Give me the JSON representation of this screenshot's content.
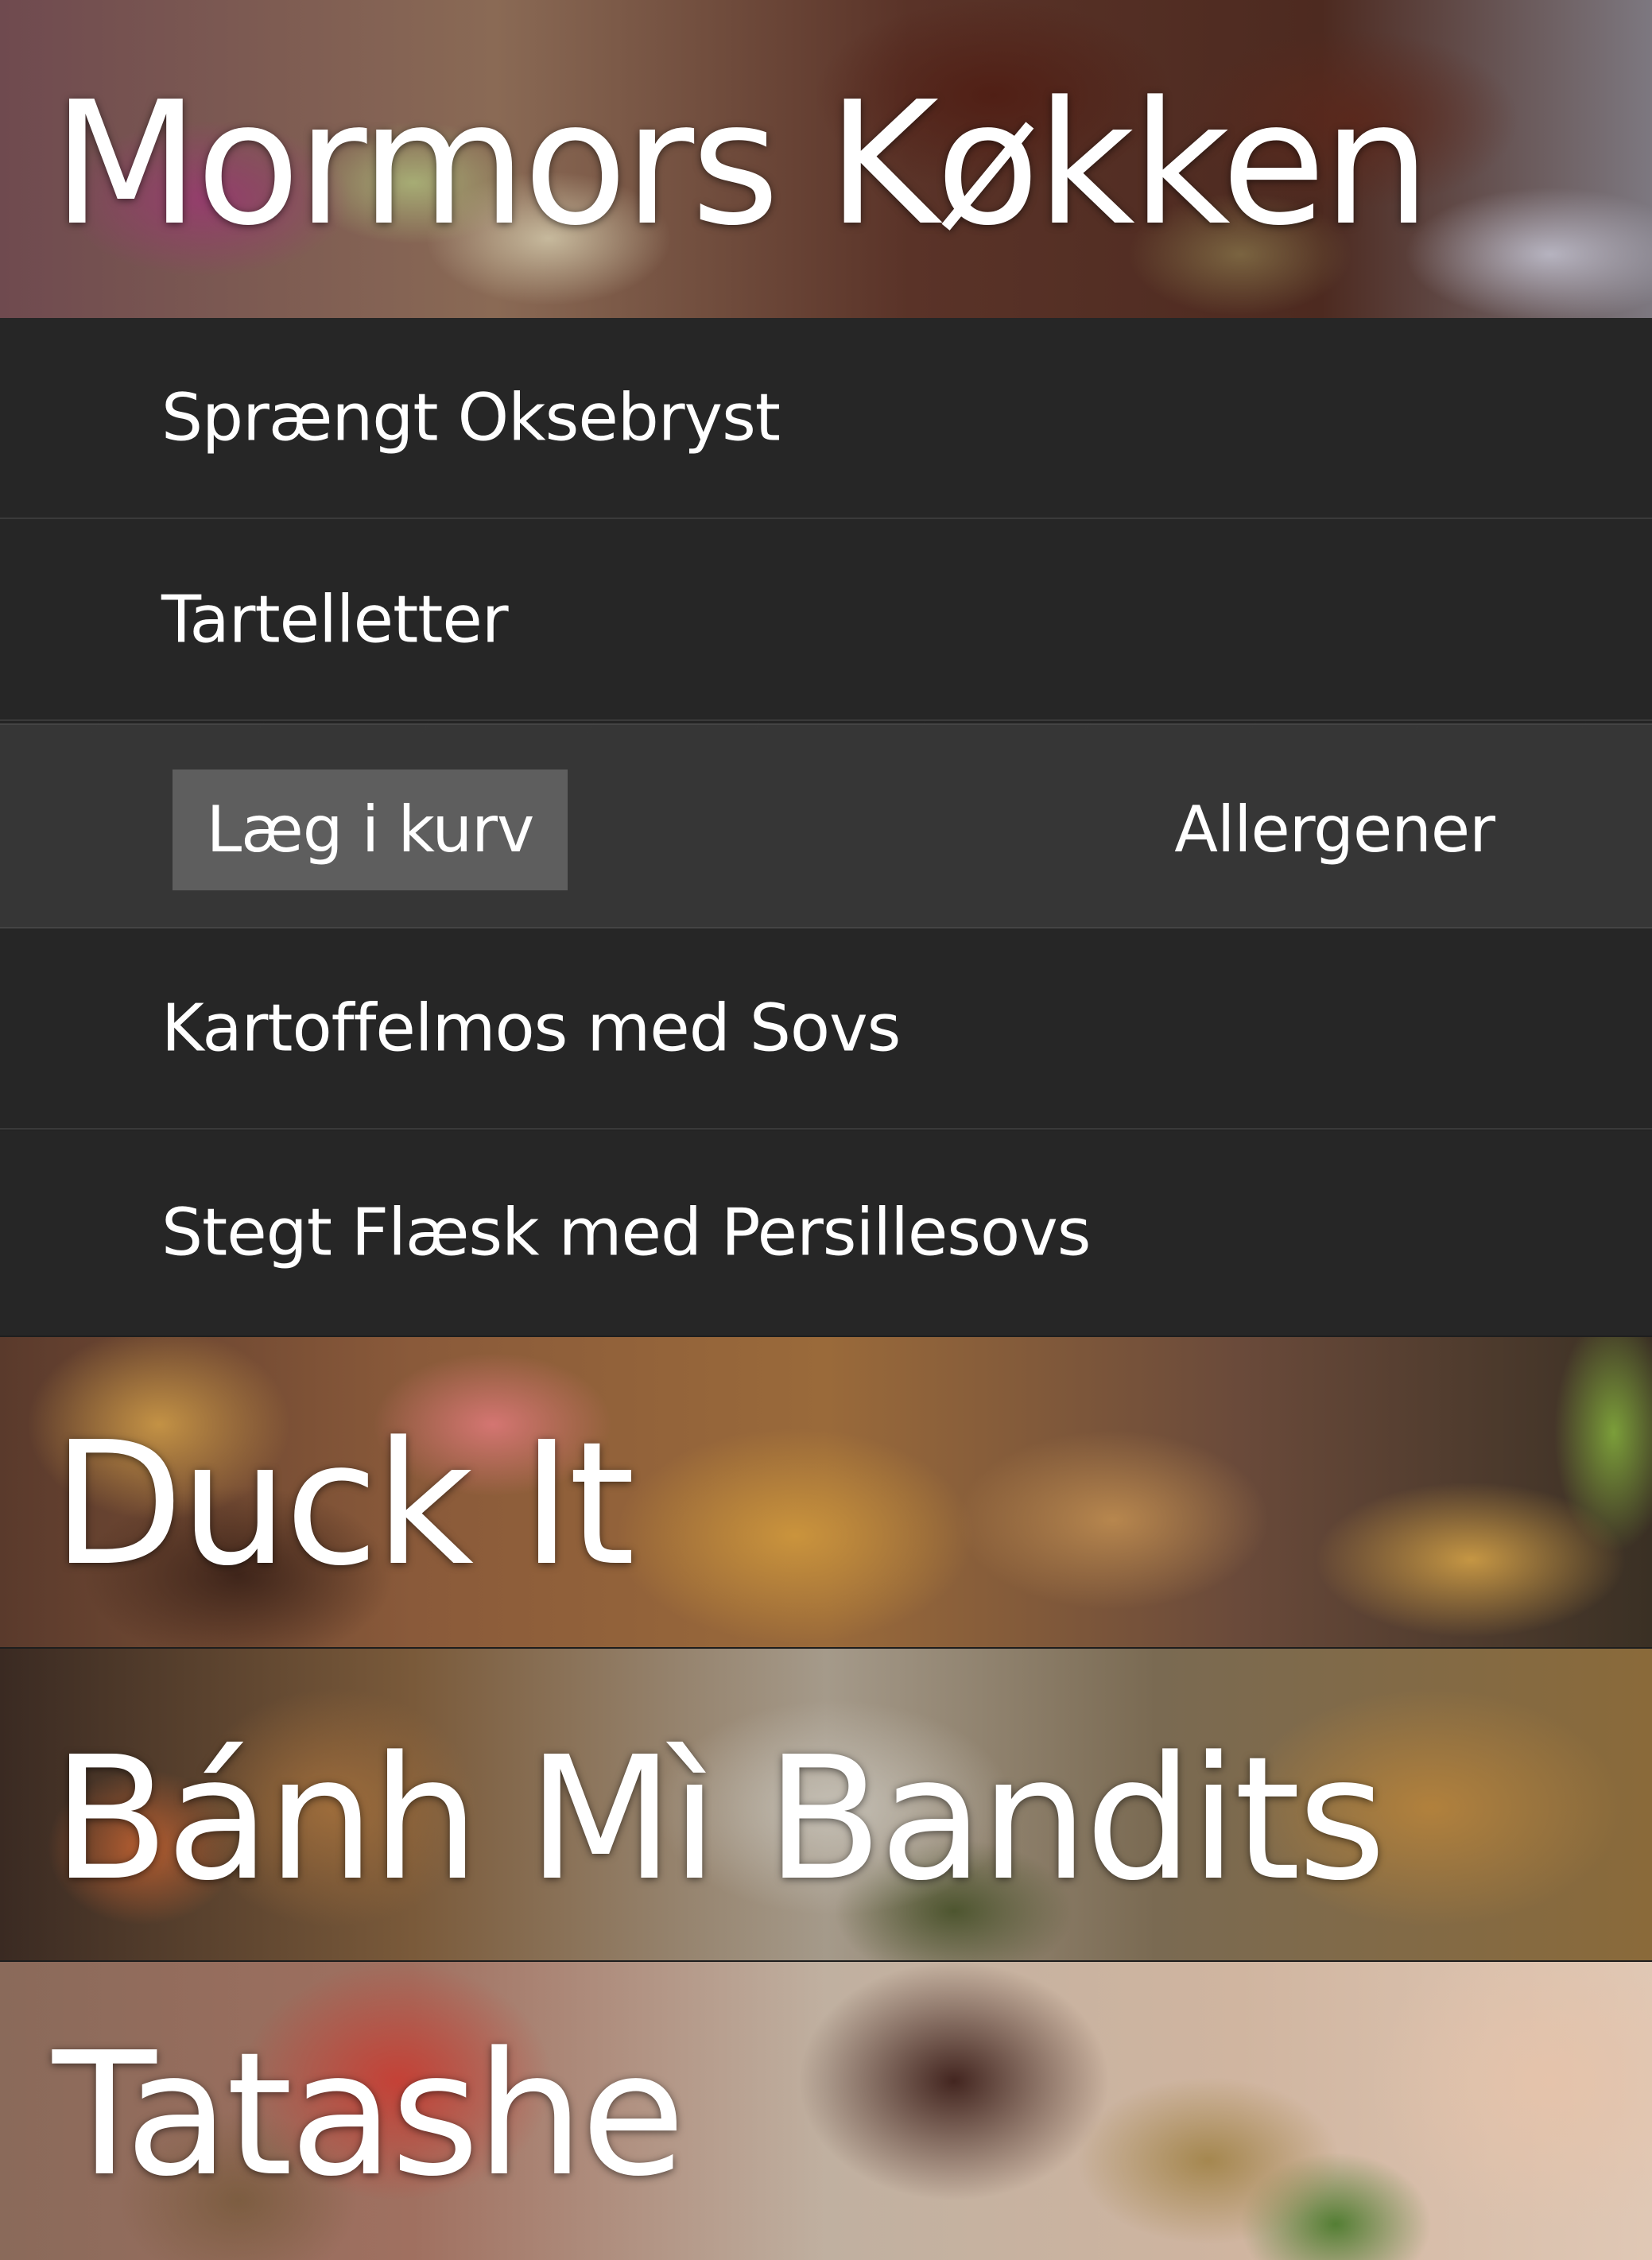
{
  "restaurants": [
    {
      "name": "Mormors Køkken"
    },
    {
      "name": "Duck It"
    },
    {
      "name": "Bánh Mì Bandits"
    },
    {
      "name": "Tatashe"
    }
  ],
  "menu": {
    "items": [
      {
        "label": "Sprængt Oksebryst"
      },
      {
        "label": "Tartelletter"
      },
      {
        "label": "Kartoffelmos med Sovs"
      },
      {
        "label": "Stegt Flæsk med Persillesovs"
      }
    ],
    "actions": {
      "add_to_cart_label": "Læg i kurv",
      "allergens_label": "Allergener"
    }
  },
  "colors": {
    "menu_background": "#262626",
    "action_row_background": "#383838",
    "cart_button_background": "#5e5e5e",
    "text": "#ffffff"
  }
}
